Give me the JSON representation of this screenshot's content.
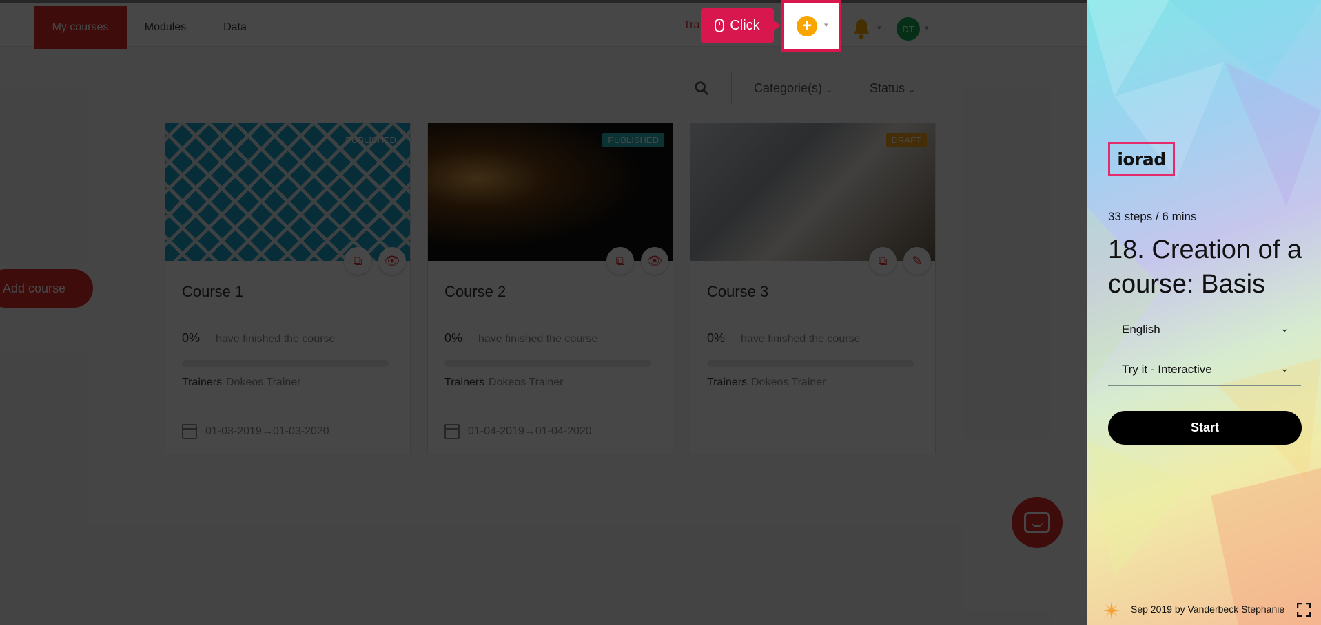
{
  "nav": {
    "tabs": [
      {
        "label": "My courses",
        "active": true
      },
      {
        "label": "Modules",
        "active": false
      },
      {
        "label": "Data",
        "active": false
      }
    ],
    "partial_text": "Tra",
    "click_hint": "Click",
    "avatar_initials": "DT"
  },
  "filters": {
    "categories": "Categorie(s)",
    "status": "Status"
  },
  "add_course_label": "Add course",
  "courses": [
    {
      "title": "Course 1",
      "badge": "PUBLISHED",
      "badge_style": "plain",
      "percent": "0%",
      "progress": 0,
      "finished_text": "have finished the course",
      "trainers_label": "Trainers",
      "trainers": "Dokeos Trainer",
      "dates": "01-03-2019→01-03-2020",
      "action_icon": "eye-icon"
    },
    {
      "title": "Course 2",
      "badge": "PUBLISHED",
      "badge_style": "pub",
      "percent": "0%",
      "progress": 0,
      "finished_text": "have finished the course",
      "trainers_label": "Trainers",
      "trainers": "Dokeos Trainer",
      "dates": "01-04-2019→01-04-2020",
      "action_icon": "eye-icon"
    },
    {
      "title": "Course 3",
      "badge": "DRAFT",
      "badge_style": "draft",
      "percent": "0%",
      "progress": 0,
      "finished_text": "have finished the course",
      "trainers_label": "Trainers",
      "trainers": "Dokeos Trainer",
      "dates": "",
      "action_icon": "pencil-icon"
    }
  ],
  "panel": {
    "logo": "iorad",
    "steps": "33 steps / 6 mins",
    "title": "18. Creation of a course: Basis",
    "language": "English",
    "mode": "Try it - Interactive",
    "start_label": "Start",
    "author": "Sep 2019 by Vanderbeck Stephanie"
  },
  "colors": {
    "brand_red": "#e32b2b",
    "highlight_pink": "#d9174f",
    "published_teal": "#2bb8b8",
    "draft_orange": "#f6a21a"
  }
}
